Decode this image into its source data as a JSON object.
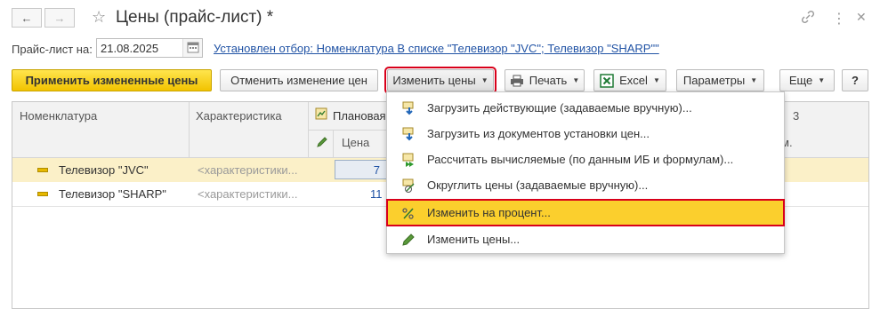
{
  "window": {
    "title": "Цены (прайс-лист) *",
    "back_glyph": "←",
    "forward_glyph": "→",
    "star_glyph": "☆",
    "link_glyph": "🔗",
    "more_glyph": "⋮",
    "close_glyph": "✕"
  },
  "filter": {
    "price_list_label": "Прайс-лист на:",
    "date_value": "21.08.2025",
    "selection_link": "Установлен отбор: Номенклатура В списке \"Телевизор \"JVC\"; Телевизор \"SHARP\"\""
  },
  "toolbar": {
    "apply_label": "Применить измененные цены",
    "cancel_label": "Отменить изменение цен",
    "change_prices_label": "Изменить цены",
    "print_label": "Печать",
    "excel_label": "Excel",
    "params_label": "Параметры",
    "more_label": "Еще",
    "help_label": "?"
  },
  "table": {
    "headers": {
      "nomenclature": "Номенклатура",
      "characteristic": "Характеристика",
      "planned": "Плановая",
      "price": "Цена",
      "col_partial_top": "3",
      "col_partial_bottom": "м."
    },
    "rows": [
      {
        "name": "Телевизор \"JVC\"",
        "characteristic": "<характеристики...",
        "price": "7"
      },
      {
        "name": "Телевизор \"SHARP\"",
        "characteristic": "<характеристики...",
        "price": "11"
      }
    ]
  },
  "menu": {
    "items": [
      {
        "label": "Загрузить действующие (задаваемые вручную)..."
      },
      {
        "label": "Загрузить из документов установки цен..."
      },
      {
        "label": "Рассчитать вычисляемые (по данным ИБ и формулам)..."
      },
      {
        "label": "Округлить цены (задаваемые вручную)..."
      },
      {
        "label": "Изменить на процент..."
      },
      {
        "label": "Изменить цены..."
      }
    ]
  },
  "colors": {
    "accent_yellow": "#f2c300",
    "highlight_red": "#d8001a",
    "link_blue": "#2153a5",
    "selected_row": "#fbf0c8"
  }
}
